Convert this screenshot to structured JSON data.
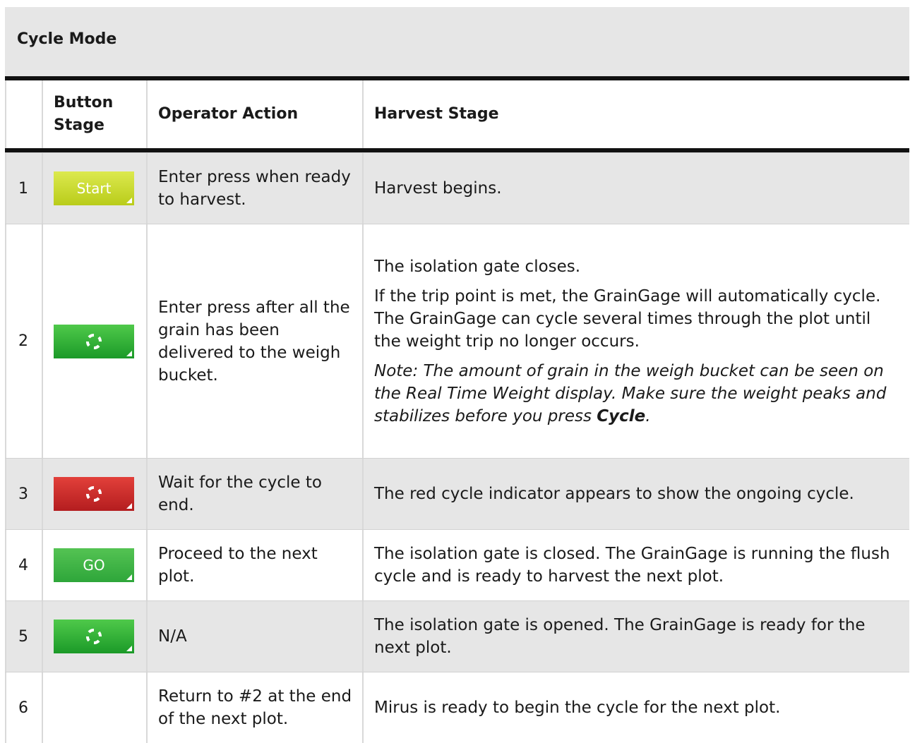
{
  "title": "Cycle Mode",
  "headers": {
    "stage": "Button Stage",
    "action": "Operator Action",
    "harvest": "Harvest Stage"
  },
  "rows": [
    {
      "num": "1",
      "button": {
        "label": "Start",
        "icon": "start-button",
        "color": "#cbdc2e"
      },
      "action": "Enter press when ready to harvest.",
      "harvest": "Harvest begins."
    },
    {
      "num": "2",
      "button": {
        "label": "",
        "icon": "cycle-icon",
        "color": "#2fb13a"
      },
      "action": "Enter press after all the grain has been delivered to the weigh bucket.",
      "harvest_p1": "The isolation gate closes.",
      "harvest_p2": "If the trip point is met, the GrainGage will automatically cycle. The GrainGage can cycle several times through the plot until the weight trip no longer occurs.",
      "note_prefix": "Note: The amount of grain in the weigh bucket can be seen on the Real Time Weight display. Make sure the weight peaks and stabilizes before you press ",
      "note_bold": "Cycle",
      "note_suffix": "."
    },
    {
      "num": "3",
      "button": {
        "label": "",
        "icon": "cycle-icon",
        "color": "#c9272a"
      },
      "action": "Wait for the cycle to end.",
      "harvest": "The red cycle indicator appears to show the ongoing cycle."
    },
    {
      "num": "4",
      "button": {
        "label": "GO",
        "icon": "go-button",
        "color": "#3bb646"
      },
      "action": "Proceed to the next plot.",
      "harvest": "The isolation gate is closed. The GrainGage is running the flush cycle and is ready to harvest the next plot."
    },
    {
      "num": "5",
      "button": {
        "label": "",
        "icon": "cycle-icon",
        "color": "#2fb13a"
      },
      "action": "N/A",
      "harvest": "The isolation gate is opened. The GrainGage is ready for the next plot."
    },
    {
      "num": "6",
      "button": null,
      "action": "Return to #2 at the end of the next plot.",
      "harvest": "Mirus is ready to begin the cycle for the next plot."
    }
  ]
}
